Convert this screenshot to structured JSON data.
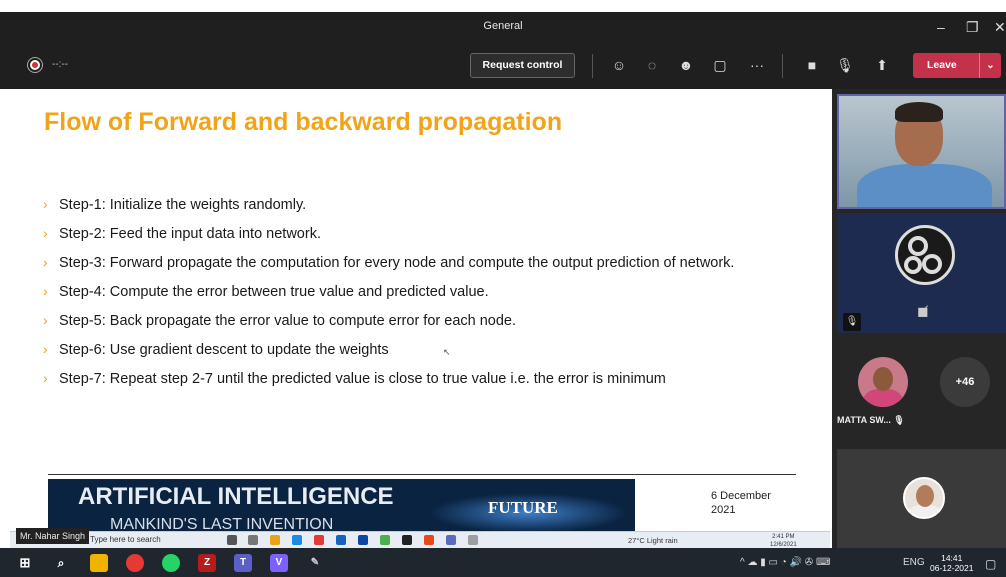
{
  "window": {
    "title": "General"
  },
  "meeting": {
    "timer": "--:--",
    "request_control": "Request control",
    "leave": "Leave"
  },
  "slide": {
    "title": "Flow of Forward and backward propagation",
    "steps": [
      "Step-1: Initialize the weights randomly.",
      "Step-2: Feed the input data into network.",
      "Step-3: Forward propagate the computation for every node and compute the output prediction of  network.",
      "Step-4: Compute the error between true value and predicted value.",
      "Step-5: Back propagate the error value to compute error for each node.",
      "Step-6: Use gradient descent to update the weights",
      "Step-7: Repeat step 2-7 until the predicted value is close to true value i.e. the error is minimum"
    ],
    "banner_main": "ARTIFICIAL INTELLIGENCE",
    "banner_sub": "MANKIND'S LAST INVENTION",
    "banner_future": "FUTURE",
    "date_line1": "6 December",
    "date_line2": "2021"
  },
  "presenter": {
    "name": "Mr. Nahar Singh"
  },
  "inner_taskbar": {
    "search": "Type here to search",
    "weather": "27°C  Light rain",
    "time": "2:41 PM",
    "date": "12/6/2021"
  },
  "participants": {
    "visible_name": "MATTA SW...",
    "more_count": "+46"
  },
  "taskbar": {
    "language": "ENG",
    "time": "14:41",
    "date": "06-12-2021"
  },
  "colors": {
    "title_orange": "#f2a317",
    "leave_red": "#c4314b",
    "teams_dark": "#1f1f1f",
    "accent": "#6264a7"
  }
}
